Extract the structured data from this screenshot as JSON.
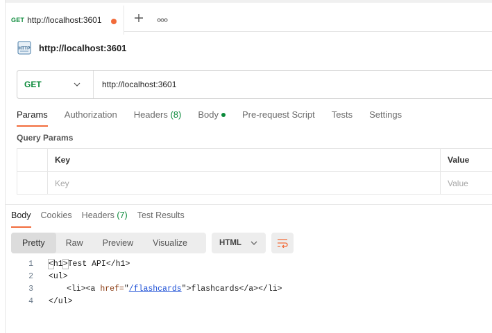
{
  "tab": {
    "method": "GET",
    "url": "http://localhost:3601"
  },
  "request": {
    "title": "http://localhost:3601",
    "method": "GET",
    "url": "http://localhost:3601"
  },
  "request_tabs": [
    {
      "label": "Params"
    },
    {
      "label": "Authorization"
    },
    {
      "label": "Headers",
      "count": "(8)"
    },
    {
      "label": "Body"
    },
    {
      "label": "Pre-request Script"
    },
    {
      "label": "Tests"
    },
    {
      "label": "Settings"
    }
  ],
  "query_params": {
    "title": "Query Params",
    "key_header": "Key",
    "value_header": "Value",
    "key_placeholder": "Key",
    "value_placeholder": "Value"
  },
  "response_tabs": [
    {
      "label": "Body"
    },
    {
      "label": "Cookies"
    },
    {
      "label": "Headers",
      "count": "(7)"
    },
    {
      "label": "Test Results"
    }
  ],
  "view_options": [
    "Pretty",
    "Raw",
    "Preview",
    "Visualize"
  ],
  "format": "HTML",
  "code": {
    "line_numbers": [
      "1",
      "2",
      "3",
      "4"
    ],
    "l1_open": "<h1>",
    "l1_text": "Test API",
    "l1_close": "</h1>",
    "l2": "<ul>",
    "l3_pre": "<li><a ",
    "l3_attr": "href=",
    "l3_q1": "\"",
    "l3_href": "/flashcards",
    "l3_q2": "\"",
    "l3_post": ">flashcards</a></li>",
    "l4": "</ul>"
  },
  "colors": {
    "accent": "#f26b3a",
    "get_method": "#0b8a3a"
  }
}
